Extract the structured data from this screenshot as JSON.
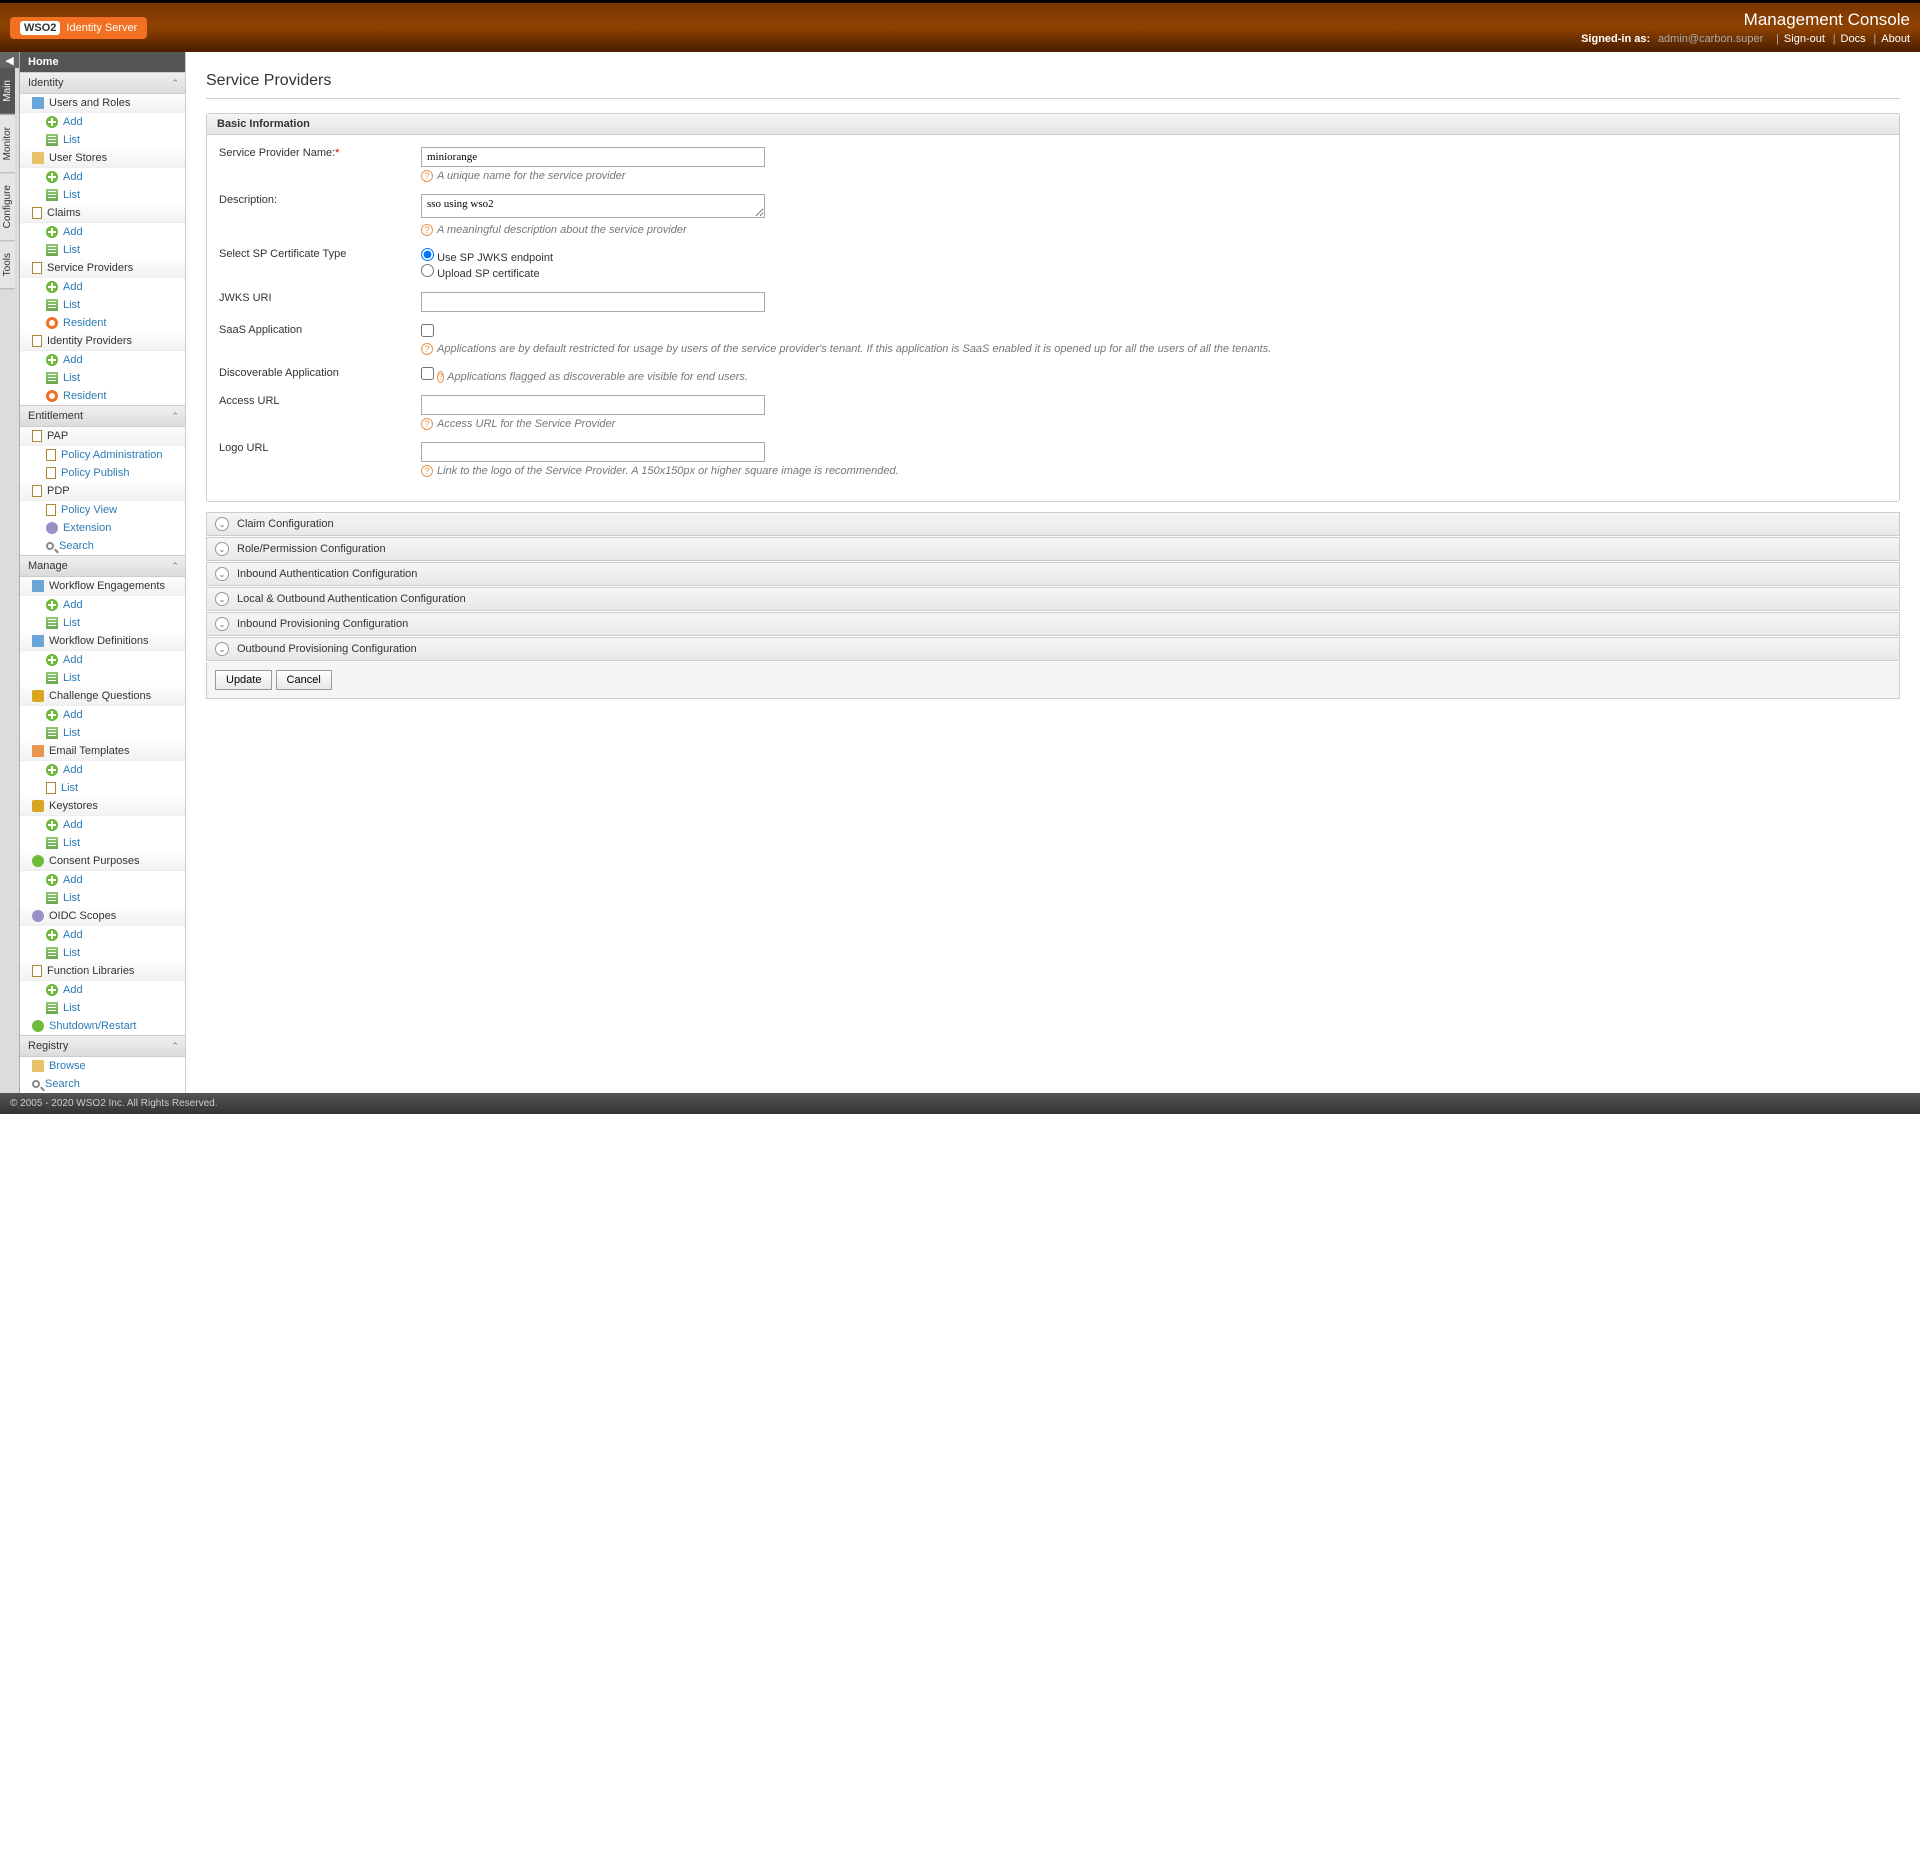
{
  "header": {
    "logo_badge": "WSO2",
    "logo_text": "Identity Server",
    "title": "Management Console",
    "signed_label": "Signed-in as:",
    "user": "admin@carbon.super",
    "signout": "Sign-out",
    "docs": "Docs",
    "about": "About"
  },
  "vtabs": [
    "Main",
    "Monitor",
    "Configure",
    "Tools"
  ],
  "home": "Home",
  "sections": {
    "identity": "Identity",
    "entitlement": "Entitlement",
    "manage": "Manage",
    "registry": "Registry"
  },
  "nav": {
    "users_roles": "Users and Roles",
    "user_stores": "User Stores",
    "claims": "Claims",
    "sp": "Service Providers",
    "idp": "Identity Providers",
    "add": "Add",
    "list": "List",
    "resident": "Resident",
    "pap": "PAP",
    "policy_admin": "Policy Administration",
    "policy_publish": "Policy Publish",
    "pdp": "PDP",
    "policy_view": "Policy View",
    "extension": "Extension",
    "search": "Search",
    "wf_eng": "Workflow Engagements",
    "wf_def": "Workflow Definitions",
    "challenge": "Challenge Questions",
    "email": "Email Templates",
    "keystores": "Keystores",
    "consent": "Consent Purposes",
    "oidc": "OIDC Scopes",
    "func_lib": "Function Libraries",
    "shutdown": "Shutdown/Restart",
    "browse": "Browse"
  },
  "page": {
    "title": "Service Providers",
    "panel": "Basic Information",
    "sp_name_label": "Service Provider Name:",
    "sp_name_value": "miniorange",
    "sp_name_help": "A unique name for the service provider",
    "desc_label": "Description:",
    "desc_value": "sso using wso2",
    "desc_help": "A meaningful description about the service provider",
    "cert_label": "Select SP Certificate Type",
    "cert_jwks": "Use SP JWKS endpoint",
    "cert_upload": "Upload SP certificate",
    "jwks_label": "JWKS URI",
    "saas_label": "SaaS Application",
    "saas_help": "Applications are by default restricted for usage by users of the service provider's tenant. If this application is SaaS enabled it is opened up for all the users of all the tenants.",
    "disc_label": "Discoverable Application",
    "disc_help": "Applications flagged as discoverable are visible for end users.",
    "access_label": "Access URL",
    "access_help": "Access URL for the Service Provider",
    "logo_label": "Logo URL",
    "logo_help": "Link to the logo of the Service Provider. A 150x150px or higher square image is recommended.",
    "acc": [
      "Claim Configuration",
      "Role/Permission Configuration",
      "Inbound Authentication Configuration",
      "Local & Outbound Authentication Configuration",
      "Inbound Provisioning Configuration",
      "Outbound Provisioning Configuration"
    ],
    "update": "Update",
    "cancel": "Cancel"
  },
  "footer": "© 2005 - 2020 WSO2 Inc. All Rights Reserved."
}
